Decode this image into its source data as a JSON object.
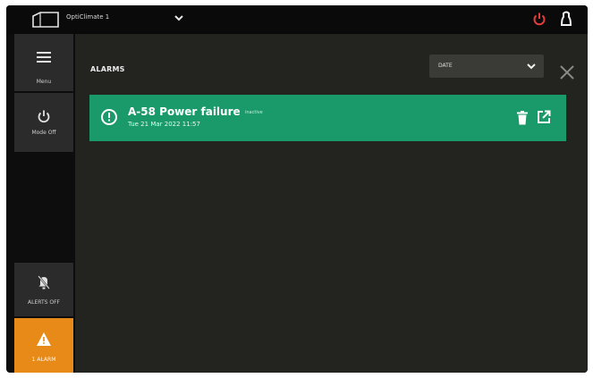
{
  "topbar": {
    "device_name": "OptiClimate 1",
    "icons": [
      "home-outline-icon",
      "chevron-down-icon",
      "power-icon",
      "user-icon"
    ],
    "power_color": "#e23d3d"
  },
  "sidebar": {
    "menu_label": "Menu",
    "mode_label": "Mode Off",
    "alerts_label": "ALERTS OFF",
    "alarm_label": "1 ALARM",
    "alarm_color": "#e88a17"
  },
  "main": {
    "title": "ALARMS",
    "sort": {
      "value": "DATE"
    },
    "alarms": [
      {
        "code": "A-58 Power failure",
        "tag": "inactive",
        "date": "Tue 21 Mar 2022 11:57",
        "color": "#1a9a6b"
      }
    ]
  }
}
